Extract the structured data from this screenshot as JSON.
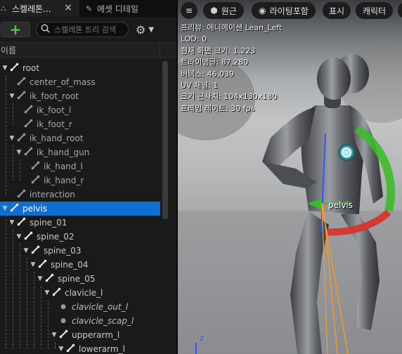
{
  "tabs": {
    "skeleton": {
      "label": "스켈레톤...",
      "close": "×"
    },
    "asset": {
      "label": "에셋 디테일"
    }
  },
  "toolbar": {
    "add_label": "+",
    "search_placeholder": "스켈레톤 트리 검색",
    "settings_icon": "gear-icon"
  },
  "tree": {
    "column_header": "이름",
    "rows": [
      {
        "label": "root",
        "depth": 0,
        "arrow": "▼",
        "type": "bone",
        "selected": false
      },
      {
        "label": "center_of_mass",
        "depth": 1,
        "arrow": "",
        "type": "bone-dim",
        "selected": false
      },
      {
        "label": "ik_foot_root",
        "depth": 1,
        "arrow": "▼",
        "type": "bone-dim",
        "selected": false
      },
      {
        "label": "ik_foot_l",
        "depth": 2,
        "arrow": "",
        "type": "bone-dim",
        "selected": false
      },
      {
        "label": "ik_foot_r",
        "depth": 2,
        "arrow": "",
        "type": "bone-dim",
        "selected": false
      },
      {
        "label": "ik_hand_root",
        "depth": 1,
        "arrow": "▼",
        "type": "bone-dim",
        "selected": false
      },
      {
        "label": "ik_hand_gun",
        "depth": 2,
        "arrow": "▼",
        "type": "bone-dim",
        "selected": false
      },
      {
        "label": "ik_hand_l",
        "depth": 3,
        "arrow": "",
        "type": "bone-dim",
        "selected": false
      },
      {
        "label": "ik_hand_r",
        "depth": 3,
        "arrow": "",
        "type": "bone-dim",
        "selected": false
      },
      {
        "label": "interaction",
        "depth": 1,
        "arrow": "",
        "type": "bone-dim",
        "selected": false
      },
      {
        "label": "pelvis",
        "depth": 0,
        "arrow": "▼",
        "type": "bone",
        "selected": true
      },
      {
        "label": "spine_01",
        "depth": 1,
        "arrow": "▼",
        "type": "bone",
        "selected": false
      },
      {
        "label": "spine_02",
        "depth": 2,
        "arrow": "▼",
        "type": "bone",
        "selected": false
      },
      {
        "label": "spine_03",
        "depth": 3,
        "arrow": "▼",
        "type": "bone",
        "selected": false
      },
      {
        "label": "spine_04",
        "depth": 4,
        "arrow": "▼",
        "type": "bone",
        "selected": false
      },
      {
        "label": "spine_05",
        "depth": 5,
        "arrow": "▼",
        "type": "bone",
        "selected": false
      },
      {
        "label": "clavicle_l",
        "depth": 6,
        "arrow": "▼",
        "type": "bone",
        "selected": false
      },
      {
        "label": "clavicle_out_l",
        "depth": 7,
        "arrow": "",
        "type": "socket",
        "selected": false
      },
      {
        "label": "clavicle_scap_l",
        "depth": 7,
        "arrow": "",
        "type": "socket",
        "selected": false
      },
      {
        "label": "upperarm_l",
        "depth": 7,
        "arrow": "▼",
        "type": "bone",
        "selected": false
      },
      {
        "label": "lowerarm_l",
        "depth": 8,
        "arrow": "▼",
        "type": "bone",
        "selected": false
      }
    ]
  },
  "viewport": {
    "menu_icon": "≡",
    "perspective_label": "원근",
    "lit_label": "라이팅포함",
    "show_label": "표시",
    "character_label": "캐릭터",
    "stats": [
      "프리뷰: 애니메이션 Lean_Left",
      "LOD: 0",
      "현재 화면 크기: 1.223",
      "트라이앵글: 87,280",
      "버텍스: 46,039",
      "UV 채널: 1",
      "크기 근사치: 104x130x180",
      "프레임 레이트: 30 fps"
    ],
    "gizmo_label": "pelvis",
    "axis_label": "z",
    "colors": {
      "x_axis": "#d9302a",
      "y_axis": "#3dbb2b",
      "z_axis": "#2f55ff",
      "selection": "#0e6fd0"
    }
  }
}
